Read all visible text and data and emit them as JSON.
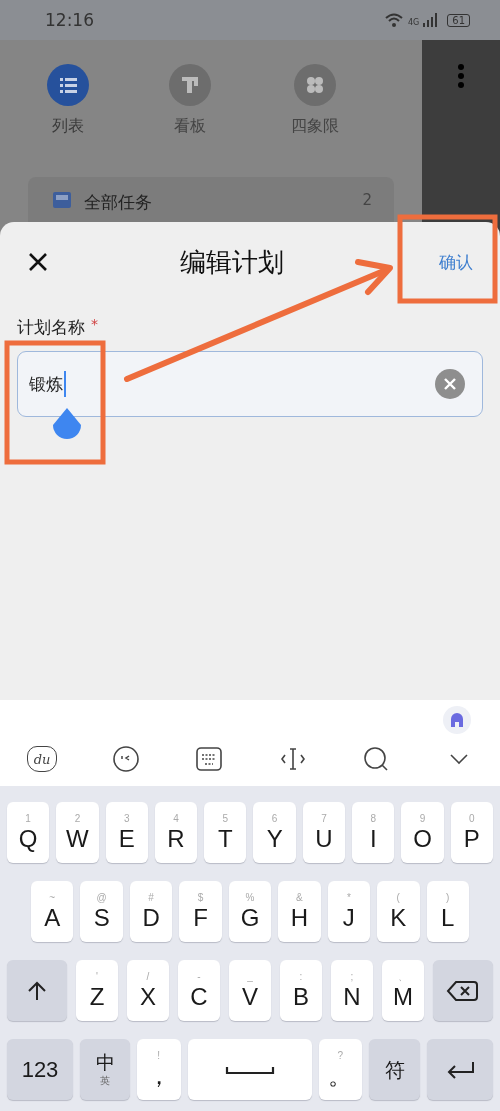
{
  "status_bar": {
    "time": "12:16",
    "network": "4G",
    "battery": "61"
  },
  "background_view": {
    "tabs": [
      {
        "label": "列表",
        "selected": true,
        "kind": "list"
      },
      {
        "label": "看板",
        "selected": false,
        "kind": "board"
      },
      {
        "label": "四象限",
        "selected": false,
        "kind": "quadrant"
      }
    ],
    "list_item": {
      "label": "全部任务",
      "count": "2"
    }
  },
  "dialog": {
    "title": "编辑计划",
    "confirm": "确认",
    "field_label": "计划名称",
    "required_mark": "*",
    "field_value": "锻炼"
  },
  "keyboard": {
    "toolbar_logo": "du",
    "rows": [
      [
        {
          "kind": "char",
          "hint": "1",
          "label": "Q"
        },
        {
          "kind": "char",
          "hint": "2",
          "label": "W"
        },
        {
          "kind": "char",
          "hint": "3",
          "label": "E"
        },
        {
          "kind": "char",
          "hint": "4",
          "label": "R"
        },
        {
          "kind": "char",
          "hint": "5",
          "label": "T"
        },
        {
          "kind": "char",
          "hint": "6",
          "label": "Y"
        },
        {
          "kind": "char",
          "hint": "7",
          "label": "U"
        },
        {
          "kind": "char",
          "hint": "8",
          "label": "I"
        },
        {
          "kind": "char",
          "hint": "9",
          "label": "O"
        },
        {
          "kind": "char",
          "hint": "0",
          "label": "P"
        }
      ],
      [
        {
          "kind": "char",
          "hint": "~",
          "label": "A"
        },
        {
          "kind": "char",
          "hint": "@",
          "label": "S"
        },
        {
          "kind": "char",
          "hint": "#",
          "label": "D"
        },
        {
          "kind": "char",
          "hint": "$",
          "label": "F"
        },
        {
          "kind": "char",
          "hint": "%",
          "label": "G"
        },
        {
          "kind": "char",
          "hint": "&",
          "label": "H"
        },
        {
          "kind": "char",
          "hint": "*",
          "label": "J"
        },
        {
          "kind": "char",
          "hint": "(",
          "label": "K"
        },
        {
          "kind": "char",
          "hint": ")",
          "label": "L"
        }
      ],
      [
        {
          "kind": "shift"
        },
        {
          "kind": "char",
          "hint": "'",
          "label": "Z"
        },
        {
          "kind": "char",
          "hint": "/",
          "label": "X"
        },
        {
          "kind": "char",
          "hint": "-",
          "label": "C"
        },
        {
          "kind": "char",
          "hint": "_",
          "label": "V"
        },
        {
          "kind": "char",
          "hint": ":",
          "label": "B"
        },
        {
          "kind": "char",
          "hint": ";",
          "label": "N"
        },
        {
          "kind": "char",
          "hint": "、",
          "label": "M"
        },
        {
          "kind": "backspace"
        }
      ],
      [
        {
          "kind": "numbers",
          "label": "123"
        },
        {
          "kind": "language",
          "label": "中",
          "hint": "英"
        },
        {
          "kind": "char",
          "hint": "!",
          "label": "，"
        },
        {
          "kind": "space"
        },
        {
          "kind": "char",
          "hint": "?",
          "label": "。"
        },
        {
          "kind": "symbols",
          "label": "符"
        },
        {
          "kind": "enter"
        }
      ]
    ]
  }
}
